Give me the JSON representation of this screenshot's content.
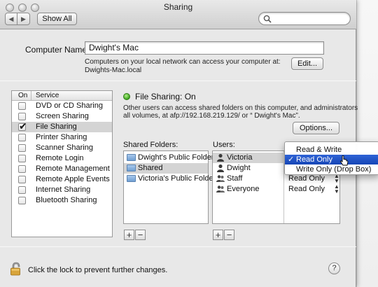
{
  "window": {
    "title": "Sharing"
  },
  "toolbar": {
    "back_icon": "back-arrow",
    "forward_icon": "forward-arrow",
    "show_all": "Show All",
    "search_placeholder": ""
  },
  "computer_name": {
    "label": "Computer Name:",
    "value": "Dwight's Mac",
    "info_line1": "Computers on your local network can access your computer at:",
    "info_line2": "Dwights-Mac.local",
    "edit_button": "Edit..."
  },
  "services": {
    "col_on": "On",
    "col_service": "Service",
    "items": [
      {
        "name": "DVD or CD Sharing",
        "checked": false,
        "selected": false
      },
      {
        "name": "Screen Sharing",
        "checked": false,
        "selected": false
      },
      {
        "name": "File Sharing",
        "checked": true,
        "selected": true
      },
      {
        "name": "Printer Sharing",
        "checked": false,
        "selected": false
      },
      {
        "name": "Scanner Sharing",
        "checked": false,
        "selected": false
      },
      {
        "name": "Remote Login",
        "checked": false,
        "selected": false
      },
      {
        "name": "Remote Management",
        "checked": false,
        "selected": false
      },
      {
        "name": "Remote Apple Events",
        "checked": false,
        "selected": false
      },
      {
        "name": "Internet Sharing",
        "checked": false,
        "selected": false
      },
      {
        "name": "Bluetooth Sharing",
        "checked": false,
        "selected": false
      }
    ]
  },
  "file_sharing": {
    "status": "File Sharing: On",
    "status_color": "#3aa51c",
    "desc_line1": "Other users can access shared folders on this computer, and administrators",
    "desc_line2": "all volumes, at afp://192.168.219.129/ or “ Dwight's Mac”.",
    "options_button": "Options..."
  },
  "shared_folders": {
    "label": "Shared Folders:",
    "items": [
      {
        "name": "Dwight's Public Folder",
        "selected": false
      },
      {
        "name": "Shared",
        "selected": true
      },
      {
        "name": "Victoria's Public Folder",
        "selected": false
      }
    ],
    "add": "+",
    "remove": "−"
  },
  "users": {
    "label": "Users:",
    "items": [
      {
        "name": "Victoria",
        "icon": "user-icon",
        "permission": "",
        "selected": true
      },
      {
        "name": "Dwight",
        "icon": "user-icon",
        "permission": "",
        "selected": false
      },
      {
        "name": "Staff",
        "icon": "group-icon",
        "permission": "Read Only",
        "selected": false
      },
      {
        "name": "Everyone",
        "icon": "group-icon",
        "permission": "Read Only",
        "selected": false
      }
    ],
    "add": "+",
    "remove": "−"
  },
  "permission_menu": {
    "items": [
      {
        "label": "Read & Write",
        "checked": false,
        "highlighted": false
      },
      {
        "label": "Read Only",
        "checked": true,
        "highlighted": true
      },
      {
        "label": "Write Only (Drop Box)",
        "checked": false,
        "highlighted": false
      }
    ],
    "check_mark": "✓",
    "highlight_color": "#1f55c8"
  },
  "footer": {
    "lock_text": "Click the lock to prevent further changes.",
    "help": "?"
  }
}
